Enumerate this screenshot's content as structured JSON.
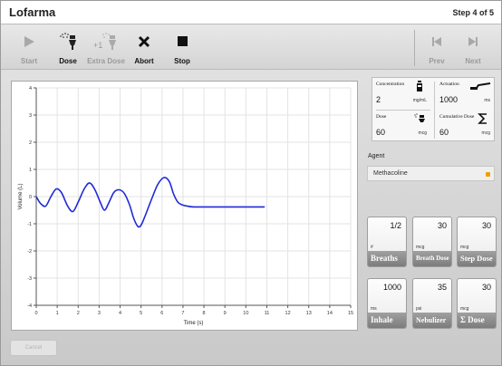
{
  "app": {
    "title": "Lofarma",
    "step": "Step 4 of 5"
  },
  "toolbar": {
    "start": "Start",
    "dose": "Dose",
    "extra_dose": "Extra Dose",
    "extra_badge": "+1",
    "abort": "Abort",
    "stop": "Stop",
    "prev": "Prev",
    "next": "Next"
  },
  "chart_data": {
    "type": "line",
    "xlabel": "Time (s)",
    "ylabel": "Volume (L)",
    "xlim": [
      0,
      15
    ],
    "ylim": [
      -4,
      4
    ],
    "xticks": [
      "0",
      "1",
      "2",
      "3",
      "4",
      "5",
      "6",
      "7",
      "8",
      "9",
      "10",
      "11",
      "12",
      "13",
      "14",
      "15"
    ],
    "yticks": [
      "4",
      "3",
      "2",
      "1",
      "0",
      "-1",
      "-2",
      "-3",
      "-4"
    ],
    "grid": true,
    "color": "#1f2ad6",
    "series": [
      {
        "x": [
          0,
          0.2,
          0.45,
          0.7,
          0.95,
          1.2,
          1.5,
          1.75,
          2.0,
          2.3,
          2.55,
          2.8,
          3.05,
          3.25,
          3.45,
          3.7,
          3.95,
          4.2,
          4.45,
          4.65,
          4.85,
          5.0,
          5.2,
          5.5,
          5.8,
          6.1,
          6.35,
          6.55,
          6.75,
          6.95,
          7.2,
          7.5,
          8,
          9,
          10,
          10.9
        ],
        "y": [
          0.0,
          -0.25,
          -0.35,
          0.0,
          0.28,
          0.15,
          -0.35,
          -0.55,
          -0.2,
          0.3,
          0.5,
          0.25,
          -0.2,
          -0.5,
          -0.25,
          0.15,
          0.25,
          0.12,
          -0.3,
          -0.8,
          -1.1,
          -1.05,
          -0.7,
          -0.1,
          0.45,
          0.7,
          0.55,
          0.1,
          -0.2,
          -0.3,
          -0.35,
          -0.38,
          -0.38,
          -0.38,
          -0.38,
          -0.38
        ]
      }
    ]
  },
  "params": {
    "concentration": {
      "label": "Concentration",
      "value": "2",
      "unit": "mg/mL"
    },
    "actuation": {
      "label": "Actuation",
      "value": "1000",
      "unit": "ms"
    },
    "dose": {
      "label": "Dose",
      "value": "60",
      "unit": "mcg"
    },
    "cumulative_dose": {
      "label": "Cumulative Dose",
      "value": "60",
      "unit": "mcg"
    }
  },
  "agent": {
    "label": "Agent",
    "value": "Methacoline"
  },
  "tiles": [
    {
      "value": "1/2",
      "unit": "#",
      "name": "Breaths"
    },
    {
      "value": "30",
      "unit": "mcg",
      "name": "Breath Dose"
    },
    {
      "value": "30",
      "unit": "mcg",
      "name": "Step Dose"
    },
    {
      "value": "1000",
      "unit": "ms",
      "name": "Inhale"
    },
    {
      "value": "35",
      "unit": "psi",
      "name": "Nebulizer"
    },
    {
      "value": "30",
      "unit": "mcg",
      "name": "Σ Dose"
    }
  ],
  "footer": {
    "cancel": "Cancel"
  }
}
